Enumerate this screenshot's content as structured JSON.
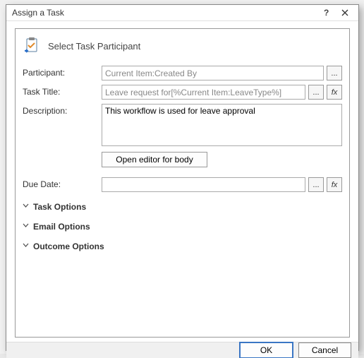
{
  "dialog": {
    "title": "Assign a Task",
    "header": "Select Task Participant",
    "labels": {
      "participant": "Participant:",
      "task_title": "Task Title:",
      "description": "Description:",
      "due_date": "Due Date:"
    },
    "fields": {
      "participant_value": "Current Item:Created By",
      "task_title_value": "Leave request for[%Current Item:LeaveType%]",
      "description_value": "This workflow is used for leave approval",
      "due_date_value": ""
    },
    "buttons": {
      "ellipsis": "...",
      "fx": "fx",
      "open_body": "Open editor for body",
      "ok": "OK",
      "cancel": "Cancel"
    },
    "sections": {
      "task_options": "Task Options",
      "email_options": "Email Options",
      "outcome_options": "Outcome Options"
    }
  }
}
